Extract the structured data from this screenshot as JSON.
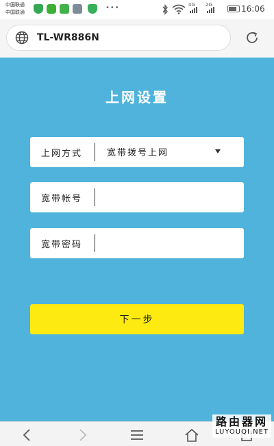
{
  "status_bar": {
    "carrier_1": "中国联通",
    "carrier_2": "中国联通",
    "net_4g": "4G",
    "net_2g": "2G",
    "time": "16:06",
    "battery_level": 0.8,
    "icons": [
      "shield-icon",
      "wechat-icon",
      "calendar-icon",
      "edit-icon",
      "image-icon",
      "security-icon",
      "bluetooth-icon",
      "wifi-icon",
      "signal-icon",
      "battery-icon"
    ]
  },
  "browser": {
    "url": "TL-WR886N",
    "icons": [
      "globe-icon",
      "reload-icon"
    ]
  },
  "page": {
    "title": "上网设置"
  },
  "form": {
    "connection_type": {
      "label": "上网方式",
      "value": "宽带拨号上网"
    },
    "username": {
      "label": "宽带帐号",
      "value": ""
    },
    "password": {
      "label": "宽带密码",
      "value": ""
    },
    "next_label": "下一步"
  },
  "bottom_nav": {
    "icons": [
      "back-icon",
      "forward-icon",
      "menu-icon",
      "home-icon",
      "tabs-icon"
    ]
  },
  "watermark": {
    "line1": "路由器网",
    "line2": "LUYOUQI.NET"
  },
  "colors": {
    "background": "#4fb3db",
    "button": "#fcea10",
    "field": "#ffffff"
  }
}
